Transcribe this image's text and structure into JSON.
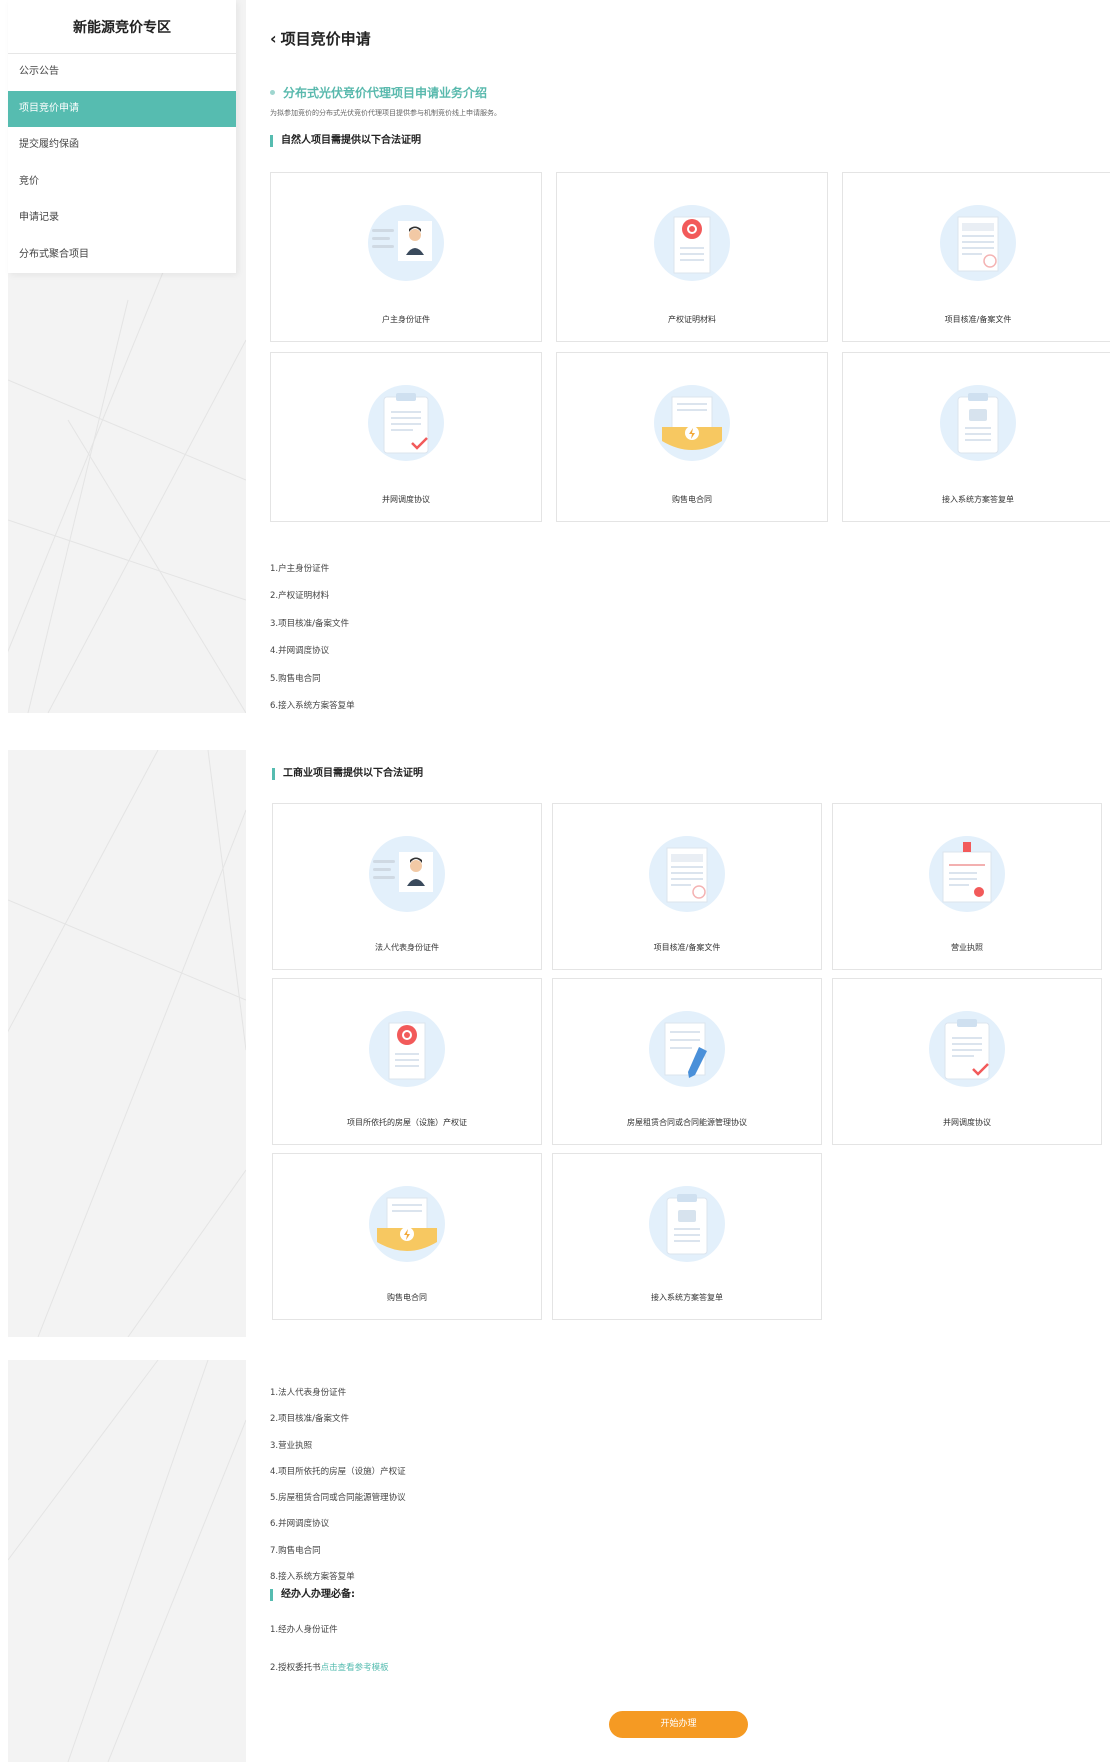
{
  "sidebar": {
    "title": "新能源竞价专区",
    "items": [
      {
        "label": "公示公告",
        "active": false
      },
      {
        "label": "项目竞价申请",
        "active": true
      },
      {
        "label": "提交履约保函",
        "active": false
      },
      {
        "label": "竞价",
        "active": false
      },
      {
        "label": "申请记录",
        "active": false
      },
      {
        "label": "分布式聚合项目",
        "active": false
      }
    ]
  },
  "header": {
    "title": "项目竞价申请"
  },
  "intro": {
    "title": "分布式光伏竞价代理项目申请业务介绍",
    "desc": "为拟参加竞价的分布式光伏竞价代理项目提供参与机制竞价线上申请服务。"
  },
  "natural": {
    "title": "自然人项目需提供以下合法证明",
    "cards": [
      {
        "label": "户主身份证件",
        "icon": "id-card-icon"
      },
      {
        "label": "产权证明材料",
        "icon": "certificate-seal-icon"
      },
      {
        "label": "项目核准/备案文件",
        "icon": "filing-document-icon"
      },
      {
        "label": "并网调度协议",
        "icon": "clipboard-check-icon"
      },
      {
        "label": "购售电合同",
        "icon": "power-contract-folder-icon"
      },
      {
        "label": "接入系统方案答复单",
        "icon": "clipboard-chat-icon"
      }
    ],
    "list": [
      "1.户主身份证件",
      "2.产权证明材料",
      "3.项目核准/备案文件",
      "4.并网调度协议",
      "5.购售电合同",
      "6.接入系统方案答复单"
    ]
  },
  "business": {
    "title": "工商业项目需提供以下合法证明",
    "cards": [
      {
        "label": "法人代表身份证件",
        "icon": "id-card-icon"
      },
      {
        "label": "项目核准/备案文件",
        "icon": "filing-document-icon"
      },
      {
        "label": "营业执照",
        "icon": "business-license-icon"
      },
      {
        "label": "项目所依托的房屋（设施）产权证",
        "icon": "certificate-seal-icon"
      },
      {
        "label": "房屋租赁合同或合同能源管理协议",
        "icon": "document-pen-icon"
      },
      {
        "label": "并网调度协议",
        "icon": "clipboard-check-icon"
      },
      {
        "label": "购售电合同",
        "icon": "power-contract-folder-icon"
      },
      {
        "label": "接入系统方案答复单",
        "icon": "clipboard-chat-icon"
      }
    ],
    "list": [
      "1.法人代表身份证件",
      "2.项目核准/备案文件",
      "3.营业执照",
      "4.项目所依托的房屋（设施）产权证",
      "5.房屋租赁合同或合同能源管理协议",
      "6.并网调度协议",
      "7.购售电合同",
      "8.接入系统方案答复单"
    ]
  },
  "agent": {
    "title": "经办人办理必备:",
    "item1": "1.经办人身份证件",
    "item2_prefix": "2.授权委托书",
    "item2_link": "点击查看参考模板"
  },
  "start_button": "开始办理",
  "colors": {
    "accent": "#56bcb0",
    "button": "#f59a23",
    "icon_bg": "#e3f0fb"
  }
}
